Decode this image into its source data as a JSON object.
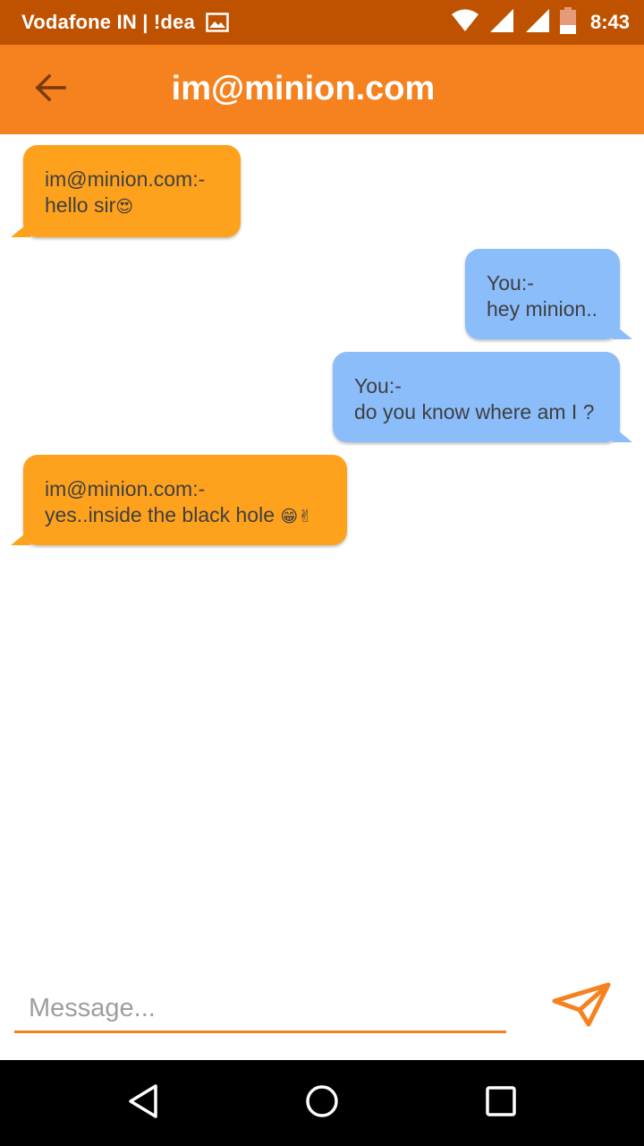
{
  "status_bar": {
    "carrier": "Vodafone IN | !dea",
    "time": "8:43",
    "icons": [
      "image-icon",
      "wifi-icon",
      "signal-icon",
      "signal-icon",
      "battery-icon"
    ]
  },
  "app_bar": {
    "title": "im@minion.com",
    "back_icon": "arrow-left-icon"
  },
  "messages": [
    {
      "direction": "incoming",
      "sender": "im@minion.com:-",
      "text": "hello sir",
      "emoji": "😍"
    },
    {
      "direction": "outgoing",
      "sender": "You:-",
      "text": "hey minion..",
      "emoji": ""
    },
    {
      "direction": "outgoing",
      "sender": "You:-",
      "text": "do you know where am I ?",
      "emoji": ""
    },
    {
      "direction": "incoming",
      "sender": "im@minion.com:-",
      "text": "yes..inside the black hole ",
      "emoji": "😁✌"
    }
  ],
  "composer": {
    "placeholder": "Message...",
    "send_icon": "send-icon"
  },
  "colors": {
    "status_bar": "#bf5200",
    "app_bar": "#f5821f",
    "incoming_bubble": "#fea21e",
    "outgoing_bubble": "#8bbdfb",
    "nav_bar": "#000000"
  },
  "nav_bar": {
    "icons": [
      "back-triangle-icon",
      "home-circle-icon",
      "recents-square-icon"
    ]
  }
}
